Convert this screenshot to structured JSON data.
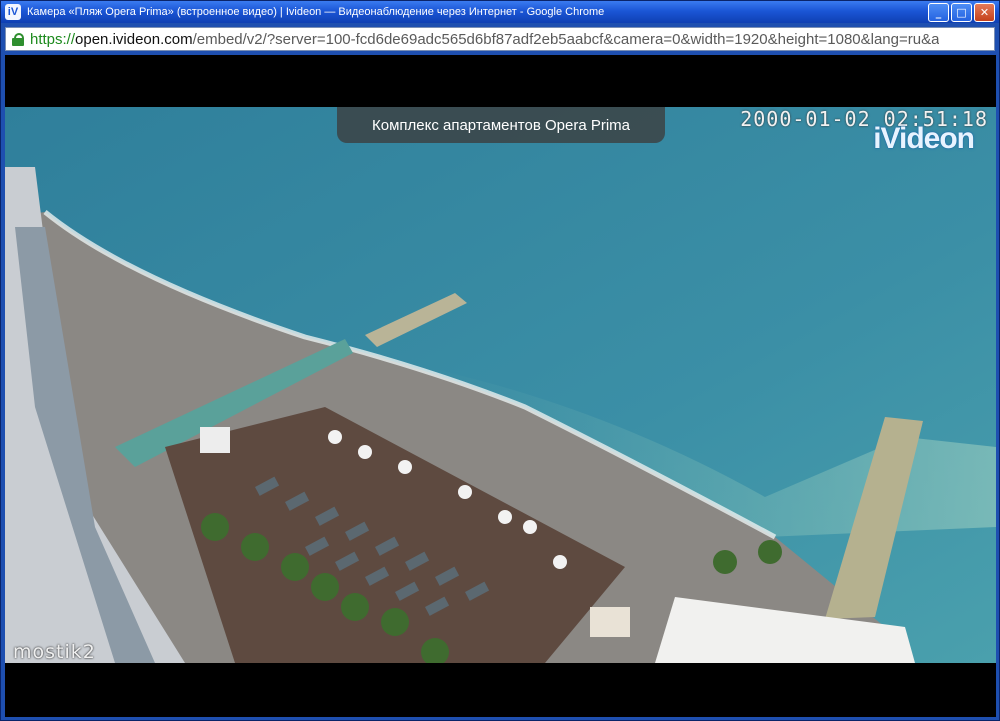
{
  "window": {
    "title": "Камера «Пляж Opera Prima» (встроенное видео) | Ivideon — Видеонаблюдение через Интернет - Google Chrome",
    "app_icon": "iV",
    "icons": [
      "minimize-icon",
      "maximize-icon",
      "close-icon"
    ]
  },
  "address_bar": {
    "scheme": "https://",
    "host": "open.ivideon.com",
    "path": "/embed/v2/?server=100-fcd6de69adc565d6bf87adf2eb5aabcf&camera=0&width=1920&height=1080&lang=ru&a"
  },
  "video": {
    "caption": "Комплекс апартаментов Opera Prima",
    "timestamp": "2000-01-02 02:51:18",
    "logo": "iVideon",
    "camera_label": "mostik2"
  },
  "colors": {
    "sea": "#3b8fa6",
    "sand": "#8a8782",
    "titlebar": "#1b56d6"
  }
}
